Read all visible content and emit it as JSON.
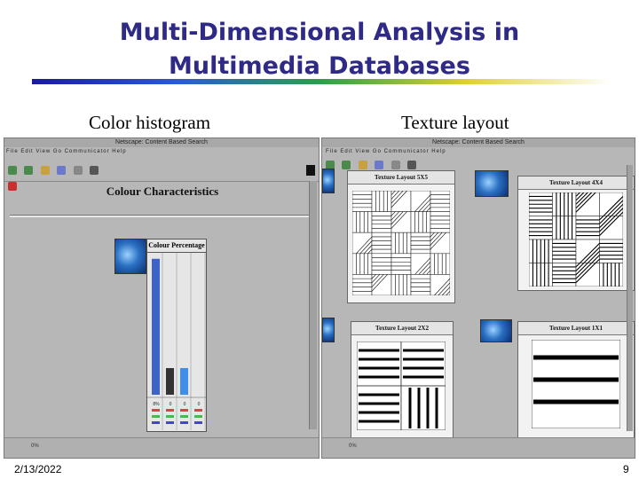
{
  "slide": {
    "title_line1": "Multi-Dimensional Analysis in",
    "title_line2": "Multimedia Databases",
    "caption_left": "Color histogram",
    "caption_right": "Texture layout",
    "date": "2/13/2022",
    "page_number": "9"
  },
  "left_window": {
    "title": "Netscape: Content Based Search",
    "menu": "File  Edit  View  Go  Communicator  Help",
    "heading": "Colour Characteristics",
    "table_header": "Colour Percentage",
    "status": "0%",
    "bars": [
      {
        "color": "#3d63c9",
        "fraction": 0.97,
        "label": "8%"
      },
      {
        "color": "#333333",
        "fraction": 0.19,
        "label": "0"
      },
      {
        "color": "#3f8ee8",
        "fraction": 0.19,
        "label": "0"
      },
      {
        "color": "#cfcfcf",
        "fraction": 0.0,
        "label": "0"
      }
    ]
  },
  "right_window": {
    "title": "Netscape: Content Based Search",
    "menu": "File  Edit  View  Go  Communicator  Help",
    "status": "0%",
    "boxes": [
      {
        "label": "Texture Layout 5X5"
      },
      {
        "label": "Texture Layout 4X4"
      },
      {
        "label": "Texture Layout 2X2"
      },
      {
        "label": "Texture Layout 1X1"
      }
    ]
  },
  "colors": {
    "title": "#2e2a86",
    "rule_start": "#1a1aa0",
    "rule_end": "#ffffff",
    "panel_bg": "#b7b7b7"
  },
  "icons": [
    "fish-thumbnail-icon",
    "back-icon",
    "forward-icon",
    "reload-icon",
    "home-icon",
    "search-icon",
    "print-icon",
    "stop-icon",
    "netscape-logo-icon"
  ]
}
